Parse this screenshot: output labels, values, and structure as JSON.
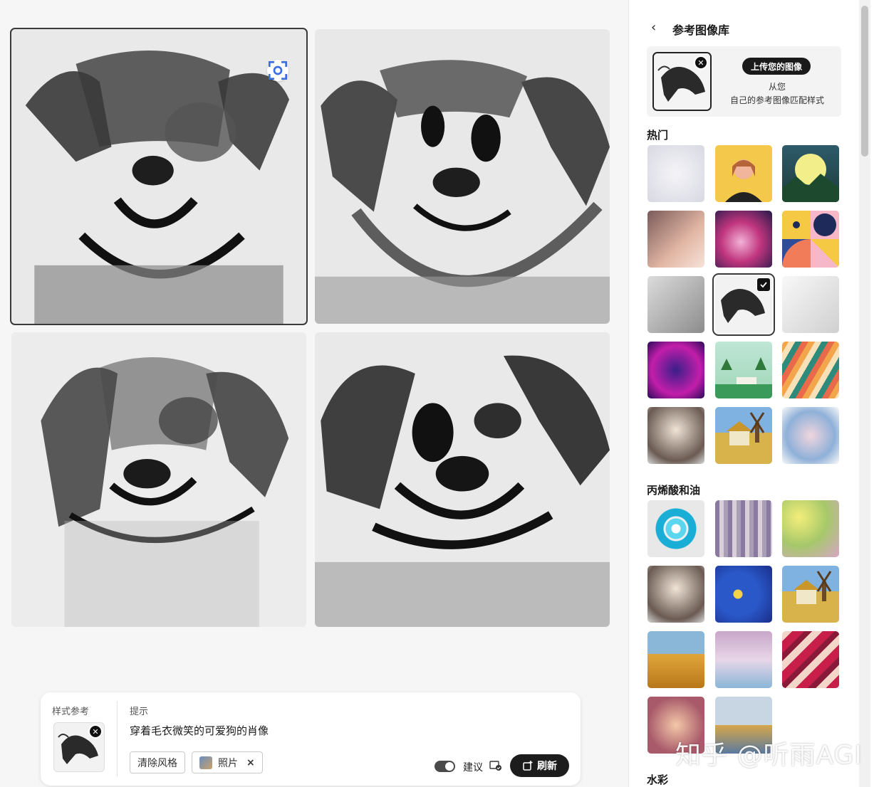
{
  "main": {
    "images": [
      {
        "name": "generated-image-1",
        "selected": true
      },
      {
        "name": "generated-image-2",
        "selected": false
      },
      {
        "name": "generated-image-3",
        "selected": false
      },
      {
        "name": "generated-image-4",
        "selected": false
      }
    ]
  },
  "prompt_panel": {
    "style_ref_label": "样式参考",
    "prompt_label": "提示",
    "prompt_text": "穿着毛衣微笑的可爱狗的肖像",
    "clear_style_label": "清除风格",
    "photo_chip_label": "照片",
    "chip_close": "×",
    "suggest_label": "建议",
    "refresh_label": "刷新",
    "suggest_toggle_on": true
  },
  "sidebar": {
    "back_icon": "‹",
    "title": "参考图像库",
    "upload_button": "上传您的图像",
    "upload_desc_line1": "从您",
    "upload_desc_line2": "自己的参考图像匹配样式",
    "sections": [
      {
        "title": "热门"
      },
      {
        "title": "丙烯酸和油"
      },
      {
        "title": "水彩"
      }
    ]
  },
  "watermark": "知乎 @听雨AGI",
  "colors": {
    "accent_dark": "#1c1c1c",
    "page_bg": "#f6f6f6",
    "sidebar_bg": "#ffffff"
  },
  "icons": [
    "scan-icon",
    "close-icon",
    "back-chevron-icon",
    "refresh-add-icon",
    "suggest-icon",
    "check-icon"
  ]
}
